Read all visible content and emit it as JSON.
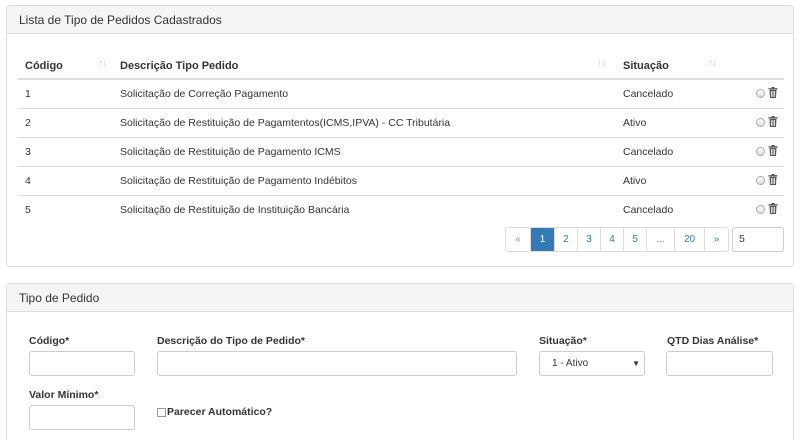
{
  "list_panel": {
    "title": "Lista de Tipo de Pedidos Cadastrados",
    "columns": {
      "code": "Código",
      "description": "Descrição Tipo Pedido",
      "status": "Situação"
    },
    "rows": [
      {
        "code": "1",
        "description": "Solicitação de Correção Pagamento",
        "status": "Cancelado"
      },
      {
        "code": "2",
        "description": "Solicitação de Restituição de Pagamtentos(ICMS,IPVA) - CC Tributária",
        "status": "Ativo"
      },
      {
        "code": "3",
        "description": "Solicitação de Restituição de Pagamento ICMS",
        "status": "Cancelado"
      },
      {
        "code": "4",
        "description": "Solicitação de Restituição de Pagamento Indébitos",
        "status": "Ativo"
      },
      {
        "code": "5",
        "description": "Solicitação de Restituição de Instituição Bancária",
        "status": "Cancelado"
      }
    ],
    "pagination": {
      "prev": "«",
      "pages": [
        "1",
        "2",
        "3",
        "4",
        "5",
        "...",
        "20"
      ],
      "next": "»",
      "current": "1"
    },
    "page_size": "5"
  },
  "form_panel": {
    "title": "Tipo de Pedido",
    "code_label": "Código*",
    "description_label": "Descrição do Tipo de Pedido*",
    "status_label": "Situação*",
    "status_value": "1 - Ativo",
    "days_label": "QTD Dias Análise*",
    "min_value_label": "Valor Mínimo*",
    "auto_opinion_label": "Parecer Automático?"
  },
  "colors": {
    "accent": "#337ab7",
    "panel_heading_bg": "#f5f5f5",
    "border": "#dddddd"
  },
  "icons": {
    "sort": "sort-arrows-icon",
    "select": "radio-icon",
    "delete": "trash-icon",
    "dropdown": "chevron-down-icon"
  }
}
